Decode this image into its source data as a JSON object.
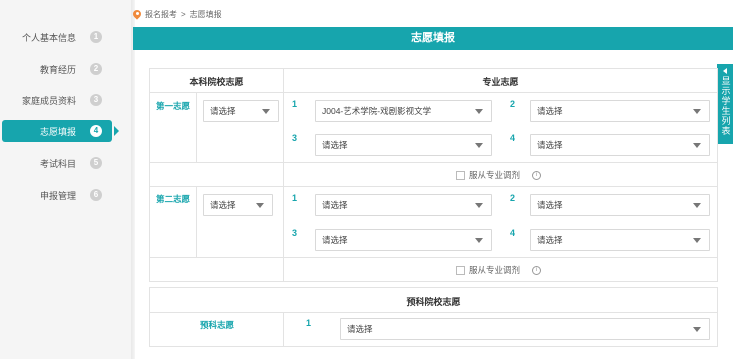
{
  "sidebar": {
    "items": [
      {
        "label": "个人基本信息",
        "num": "1"
      },
      {
        "label": "教育经历",
        "num": "2"
      },
      {
        "label": "家庭成员资料",
        "num": "3"
      },
      {
        "label": "志愿填报",
        "num": "4"
      },
      {
        "label": "考试科目",
        "num": "5"
      },
      {
        "label": "申报管理",
        "num": "6"
      }
    ],
    "active_index": 3
  },
  "breadcrumb": {
    "parent": "报名报考",
    "separator": ">",
    "current": "志愿填报"
  },
  "header": {
    "title": "志愿填报"
  },
  "side_tab": {
    "label": "显示学生列表"
  },
  "table": {
    "undergrad_header": "本科院校志愿",
    "major_header": "专业志愿",
    "rows": [
      {
        "label": "第一志愿",
        "school_select": "请选择",
        "majors": [
          {
            "index": "1",
            "value": "J004-艺术学院-戏剧影视文学"
          },
          {
            "index": "2",
            "value": "请选择"
          },
          {
            "index": "3",
            "value": "请选择"
          },
          {
            "index": "4",
            "value": "请选择"
          }
        ],
        "obey_label": "服从专业调剂"
      },
      {
        "label": "第二志愿",
        "school_select": "请选择",
        "majors": [
          {
            "index": "1",
            "value": "请选择"
          },
          {
            "index": "2",
            "value": "请选择"
          },
          {
            "index": "3",
            "value": "请选择"
          },
          {
            "index": "4",
            "value": "请选择"
          }
        ],
        "obey_label": "服从专业调剂"
      }
    ]
  },
  "prep": {
    "header": "预科院校志愿",
    "label": "预科志愿",
    "index": "1",
    "select": "请选择"
  },
  "colors": {
    "accent": "#17a5ad",
    "pin": "#f08a3c"
  }
}
